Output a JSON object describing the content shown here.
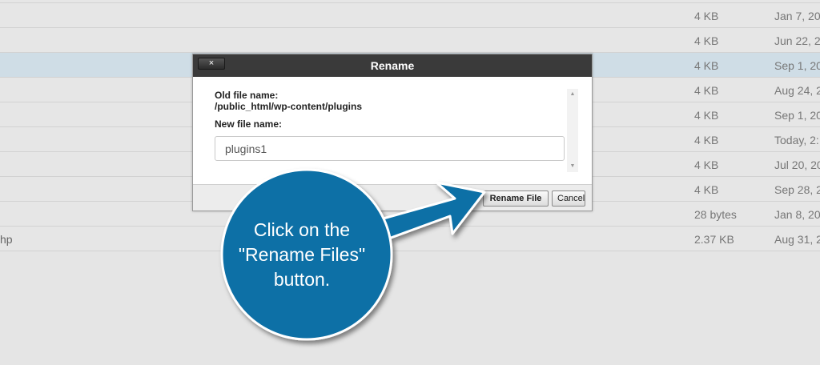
{
  "file_rows": [
    {
      "name": "",
      "size": "4 KB",
      "date": "Jan 7, 20"
    },
    {
      "name": "",
      "size": "4 KB",
      "date": "Jun 22, 2"
    },
    {
      "name": "",
      "size": "4 KB",
      "date": "Sep 1, 20"
    },
    {
      "name": "",
      "size": "4 KB",
      "date": "Aug 24, 2"
    },
    {
      "name": "",
      "size": "4 KB",
      "date": "Sep 1, 20"
    },
    {
      "name": "",
      "size": "4 KB",
      "date": "Today, 2:"
    },
    {
      "name": "",
      "size": "4 KB",
      "date": "Jul 20, 20"
    },
    {
      "name": "",
      "size": "4 KB",
      "date": "Sep 28, 2"
    },
    {
      "name": "",
      "size": "28 bytes",
      "date": "Jan 8, 20"
    },
    {
      "name": "hp",
      "size": "2.37 KB",
      "date": "Aug 31, 2"
    }
  ],
  "dialog": {
    "title": "Rename",
    "close_icon": "×",
    "old_label": "Old file name:",
    "old_path": "/public_html/wp-content/plugins",
    "new_label": "New file name:",
    "new_value": "plugins1",
    "rename_button": "Rename File",
    "cancel_button": "Cancel"
  },
  "callout": {
    "line1": "Click on the",
    "line2": "\"Rename Files\"",
    "line3": "button.",
    "color": "#0d6fa6"
  },
  "colors": {
    "selected_row": "#cfdde6",
    "dialog_header": "#3a3a3a"
  }
}
